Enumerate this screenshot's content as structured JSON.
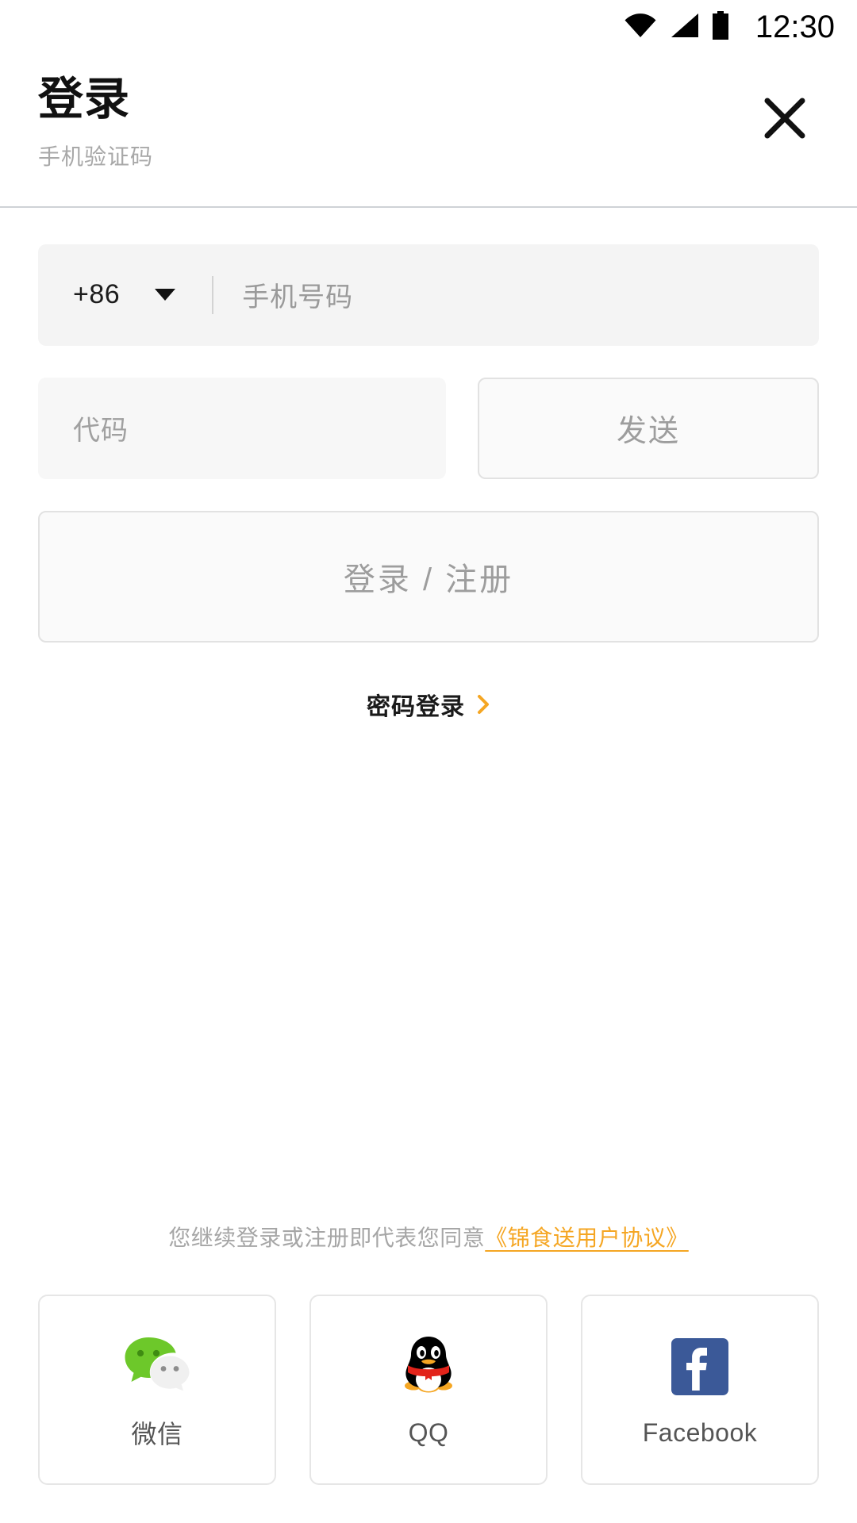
{
  "status_bar": {
    "clock": "12:30",
    "icons": [
      "wifi-icon",
      "cellular-signal-icon",
      "battery-icon"
    ]
  },
  "header": {
    "title": "登录",
    "subtitle": "手机验证码",
    "close_icon": "close-icon"
  },
  "form": {
    "country_code": "+86",
    "country_code_caret_icon": "chevron-down-icon",
    "phone_placeholder": "手机号码",
    "code_placeholder": "代码",
    "send_label": "发送",
    "submit_label": "登录 / 注册",
    "password_login_label": "密码登录",
    "password_login_chevron_icon": "chevron-right-icon"
  },
  "agreement": {
    "prefix": "您继续登录或注册即代表您同意",
    "link": "《锦食送用户协议》"
  },
  "social": {
    "items": [
      {
        "label": "微信",
        "icon": "wechat-icon"
      },
      {
        "label": "QQ",
        "icon": "qq-penguin-icon"
      },
      {
        "label": "Facebook",
        "icon": "facebook-icon"
      }
    ]
  },
  "colors": {
    "accent_orange": "#f5a623",
    "wechat_green": "#6dc82a",
    "facebook_blue": "#3b5998",
    "qq_red": "#e2231a",
    "qq_orange": "#f5a623",
    "text_primary": "#111111",
    "text_muted": "#a0a0a0",
    "field_bg": "#f4f4f4",
    "border": "#e2e2e2"
  }
}
